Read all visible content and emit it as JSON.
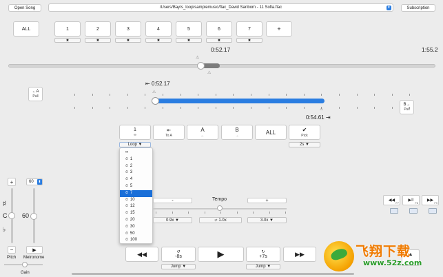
{
  "top_bar": {
    "open_song_label": "Open Song",
    "file_path": "/Users/Bay/s_loop/samplemusic/flac_David Sanborn - 11 Sofia.flac",
    "subscription_label": "Subscription"
  },
  "markers": {
    "all_label": "ALL",
    "slots": [
      "1",
      "2",
      "3",
      "4",
      "5",
      "6",
      "7"
    ],
    "delete_glyph": "✖",
    "add_label": "+"
  },
  "main_progress": {
    "current_time": "0:52.17",
    "total_time": "1:55.2",
    "position": 0.45
  },
  "loop_region": {
    "a_button": {
      "label": "←A",
      "sub": "Pull"
    },
    "b_button": {
      "label": "B→",
      "sub": "Pull"
    },
    "start_time": "0:52.17",
    "end_time": "0:54.61",
    "start_glyph": "⇤",
    "end_glyph": "⇥"
  },
  "loop_controls": {
    "count_label": "1",
    "count_sub": "∞",
    "to_a_glyph": "⇤",
    "to_a_label": "To A",
    "a_label": "A",
    "a_sub": "←",
    "b_label": "B",
    "b_sub": "→",
    "all_label": "ALL",
    "pick_glyph": "✔",
    "pick_label": "Pick",
    "loop_dropdown_label": "Loop ▼",
    "pick_dropdown_label": "2s ▼"
  },
  "loop_menu": {
    "items": [
      "∞",
      "1",
      "2",
      "3",
      "4",
      "5",
      "7",
      "10",
      "12",
      "15",
      "20",
      "30",
      "50",
      "100"
    ],
    "selected": "7",
    "timer_glyph": "⏱"
  },
  "pitch": {
    "plus_label": "+",
    "minus_label": "−",
    "sharp_label": "♯",
    "flat_label": "♭",
    "key_label": "C",
    "label": "Pitch"
  },
  "metronome": {
    "value_label": "60",
    "bpm_value": "60",
    "play_glyph": "▶",
    "label": "Metronome",
    "stepper_glyph": "⬍"
  },
  "gain": {
    "label": "Gain"
  },
  "tempo": {
    "title": "Tempo",
    "minus_label": "-",
    "plus_label": "+",
    "min_label": "0.9x ▼",
    "current_label": "1.0x",
    "current_glyph": "⇄",
    "max_label": "3.0x ▼",
    "position": 0.5
  },
  "right_controls": {
    "rewind_glyph": "◀◀",
    "rewind_key": "F7",
    "playpause_glyph": "▶II",
    "playpause_key": "F8",
    "ffwd_glyph": "▶▶",
    "ffwd_key": "F9",
    "up_glyph": "▲"
  },
  "transport": {
    "rewind_glyph": "◀◀",
    "back_label": "-8s",
    "back_glyph": "↺",
    "play_glyph": "▶",
    "forward_label": "+7s",
    "forward_glyph": "↻",
    "ffwd_glyph": "▶▶",
    "jump_back_label": "Jump ▼",
    "jump_forward_label": "Jump ▼"
  },
  "colors": {
    "accent": "#2a7de1",
    "selection": "#1a6fd8",
    "background": "#ececec"
  },
  "watermark": {
    "brand_text": "飞翔下载",
    "url_text": "www.52z.com"
  }
}
